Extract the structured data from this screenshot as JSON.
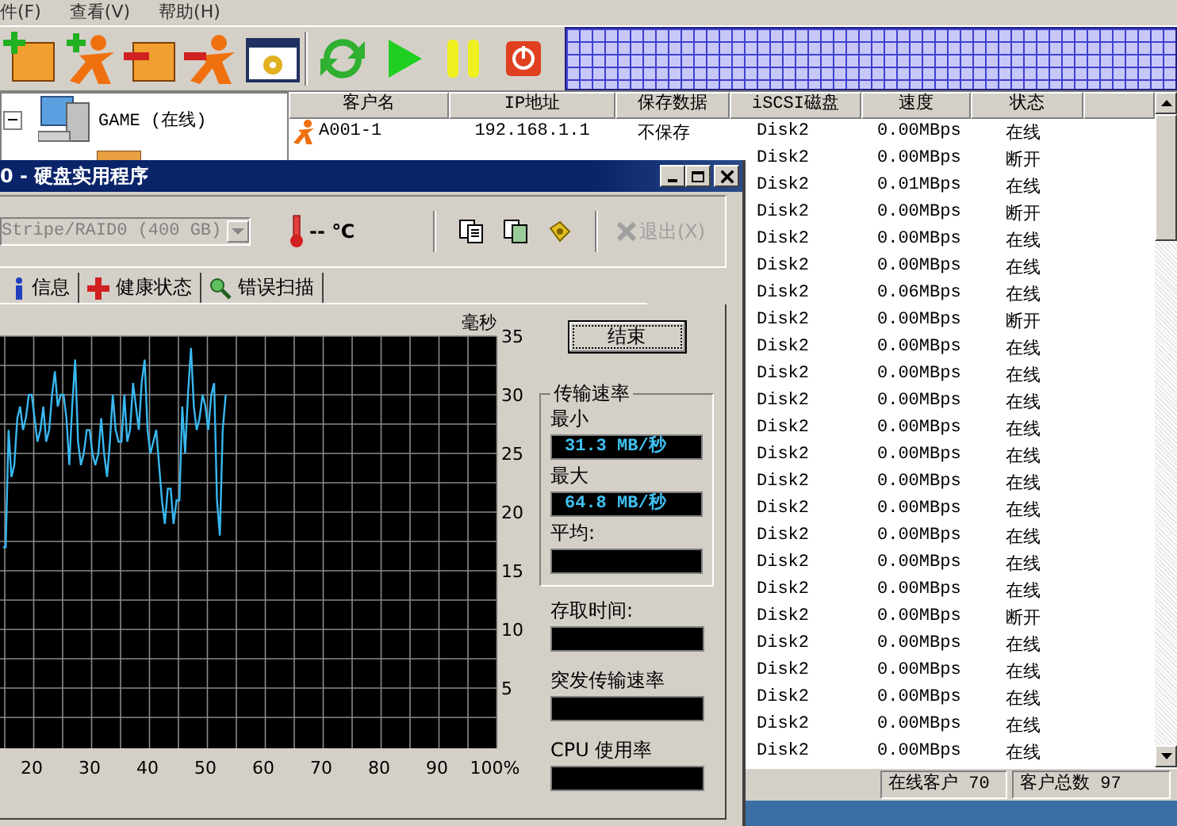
{
  "main": {
    "menu": [
      "件(F)",
      "查看(V)",
      "帮助(H)"
    ],
    "tree": {
      "label": "GAME (在线)",
      "expanded": true
    },
    "table": {
      "columns": [
        "客户名",
        "IP地址",
        "保存数据",
        "iSCSI磁盘",
        "速度",
        "状态"
      ],
      "rows": [
        {
          "client": "A001-1",
          "ip": "192.168.1.1",
          "save": "不保存",
          "disk": "Disk2",
          "speed": "0.00MBps",
          "status": "在线"
        },
        {
          "disk": "Disk2",
          "speed": "0.00MBps",
          "status": "断开"
        },
        {
          "disk": "Disk2",
          "speed": "0.01MBps",
          "status": "在线"
        },
        {
          "disk": "Disk2",
          "speed": "0.00MBps",
          "status": "断开"
        },
        {
          "disk": "Disk2",
          "speed": "0.00MBps",
          "status": "在线"
        },
        {
          "disk": "Disk2",
          "speed": "0.00MBps",
          "status": "在线"
        },
        {
          "disk": "Disk2",
          "speed": "0.06MBps",
          "status": "在线"
        },
        {
          "disk": "Disk2",
          "speed": "0.00MBps",
          "status": "断开"
        },
        {
          "disk": "Disk2",
          "speed": "0.00MBps",
          "status": "在线"
        },
        {
          "disk": "Disk2",
          "speed": "0.00MBps",
          "status": "在线"
        },
        {
          "disk": "Disk2",
          "speed": "0.00MBps",
          "status": "在线"
        },
        {
          "disk": "Disk2",
          "speed": "0.00MBps",
          "status": "在线"
        },
        {
          "disk": "Disk2",
          "speed": "0.00MBps",
          "status": "在线"
        },
        {
          "disk": "Disk2",
          "speed": "0.00MBps",
          "status": "在线"
        },
        {
          "disk": "Disk2",
          "speed": "0.00MBps",
          "status": "在线"
        },
        {
          "disk": "Disk2",
          "speed": "0.00MBps",
          "status": "在线"
        },
        {
          "disk": "Disk2",
          "speed": "0.00MBps",
          "status": "在线"
        },
        {
          "disk": "Disk2",
          "speed": "0.00MBps",
          "status": "在线"
        },
        {
          "disk": "Disk2",
          "speed": "0.00MBps",
          "status": "断开"
        },
        {
          "disk": "Disk2",
          "speed": "0.00MBps",
          "status": "在线"
        },
        {
          "disk": "Disk2",
          "speed": "0.00MBps",
          "status": "在线"
        },
        {
          "disk": "Disk2",
          "speed": "0.00MBps",
          "status": "在线"
        },
        {
          "disk": "Disk2",
          "speed": "0.00MBps",
          "status": "在线"
        },
        {
          "disk": "Disk2",
          "speed": "0.00MBps",
          "status": "在线"
        }
      ]
    },
    "status_bar": [
      "在线客户 70",
      "客户总数 97"
    ]
  },
  "dialog": {
    "title": "0 - 硬盘实用程序",
    "drive": "Stripe/RAID0 (400 GB)",
    "temperature": "-- ℃",
    "exit_button": {
      "label": "退出(X)",
      "disabled": true
    },
    "tabs": [
      {
        "label": "信息",
        "selected": false
      },
      {
        "label": "健康状态",
        "selected": false
      },
      {
        "label": "错误扫描",
        "selected": false
      }
    ],
    "chart": {
      "unit": "毫秒",
      "y_ticks": [
        "35",
        "30",
        "25",
        "20",
        "15",
        "10",
        "5"
      ],
      "x_ticks": [
        "20",
        "30",
        "40",
        "50",
        "60",
        "70",
        "80",
        "90",
        "100%"
      ]
    },
    "stop_button": "结束",
    "rate_group": {
      "title": "传输速率",
      "min_label": "最小",
      "min_value": "31.3 MB/秒",
      "max_label": "最大",
      "max_value": "64.8 MB/秒",
      "avg_label": "平均:"
    },
    "stats": [
      "存取时间:",
      "突发传输速率",
      "CPU 使用率"
    ]
  }
}
